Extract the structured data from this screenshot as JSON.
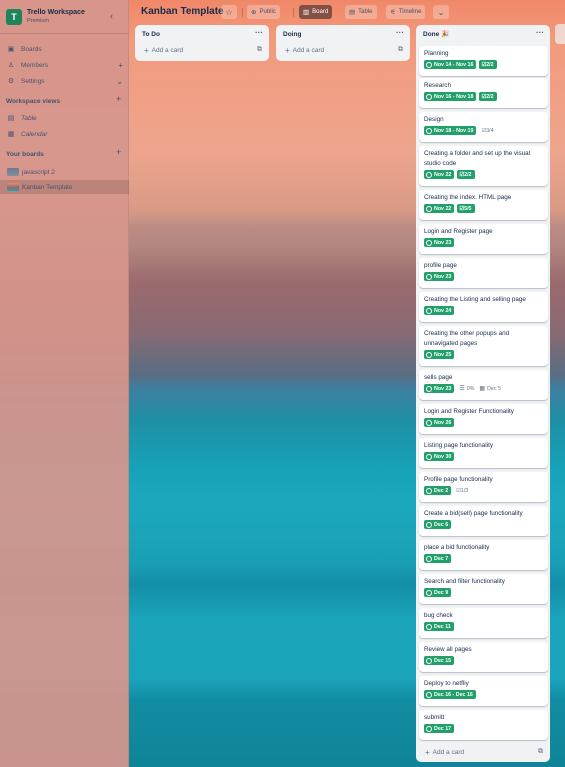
{
  "workspace": {
    "initial": "T",
    "name": "Trello Workspace",
    "plan": "Premium"
  },
  "sidebar": {
    "items": [
      {
        "label": "Boards"
      },
      {
        "label": "Members"
      },
      {
        "label": "Settings"
      }
    ],
    "views_title": "Workspace views",
    "views": [
      {
        "label": "Table"
      },
      {
        "label": "Calendar"
      }
    ],
    "boards_title": "Your boards",
    "boards": [
      {
        "label": "javascript 2"
      },
      {
        "label": "Kanban Template"
      }
    ]
  },
  "header": {
    "title": "Kanban Template",
    "visibility": "Public",
    "views": [
      {
        "label": "Board"
      },
      {
        "label": "Table"
      },
      {
        "label": "Timeline"
      }
    ]
  },
  "lists": [
    {
      "name": "To Do",
      "add_label": "Add a card"
    },
    {
      "name": "Doing",
      "add_label": "Add a card"
    },
    {
      "name": "Done 🎉",
      "add_label": "Add a card"
    }
  ],
  "done_cards": [
    {
      "title": "Planning",
      "due": "Nov 14 - Nov 16",
      "checklist": "2/2"
    },
    {
      "title": "Research",
      "due": "Nov 16 - Nov 18",
      "checklist": "2/2"
    },
    {
      "title": "Design",
      "due": "Nov 18 - Nov 19",
      "checklist_plain": "3/4"
    },
    {
      "title": "Creating a folder and set up the visual studio code",
      "due": "Nov 22",
      "checklist": "2/2"
    },
    {
      "title": "Creating the index. HTML page",
      "due": "Nov 22",
      "checklist": "5/5"
    },
    {
      "title": "Login and Register page",
      "due": "Nov 23"
    },
    {
      "title": "profile page",
      "due": "Nov 23"
    },
    {
      "title": "Creating the Listing and selling page",
      "due": "Nov 24"
    },
    {
      "title": "Creating the other popups and unnavigated pages",
      "due": "Nov 25"
    },
    {
      "title": "sells page",
      "due": "Nov 23",
      "progress": "0%",
      "date": "Dec 5"
    },
    {
      "title": "Login and Register Functionality",
      "due": "Nov 26"
    },
    {
      "title": "Listing page functionality",
      "due": "Nov 30"
    },
    {
      "title": "Profile page functionality",
      "due": "Dec 2",
      "checklist_plain": "1/3"
    },
    {
      "title": "Create a bid(sell) page functionality",
      "due": "Dec 6"
    },
    {
      "title": "place a bid functionality",
      "due": "Dec 7"
    },
    {
      "title": "Search and filter functionality",
      "due": "Dec 9"
    },
    {
      "title": "bug check",
      "due": "Dec 11"
    },
    {
      "title": "Review all pages",
      "due": "Dec 15"
    },
    {
      "title": "Deploy to netfliy",
      "due": "Dec 16 - Dec 16"
    },
    {
      "title": "submitt",
      "due": "Dec 17"
    }
  ],
  "colors": {
    "accent_green": "#22a06b",
    "workspace_logo": "#1f845a"
  },
  "icons": {
    "collapse": "chevron-left",
    "boards": "board-icon",
    "members": "person-icon",
    "settings": "gear-icon",
    "star": "star-icon",
    "due": "clock-icon",
    "checklist": "checklist-icon"
  }
}
